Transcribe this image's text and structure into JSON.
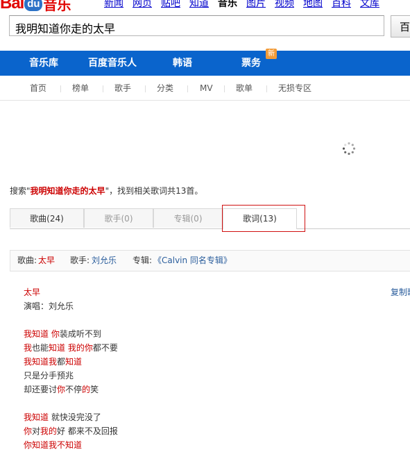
{
  "logo": {
    "bai": "Bai",
    "du": "du",
    "yinyue": "音乐"
  },
  "top_nav": [
    "新闻",
    "网页",
    "贴吧",
    "知道",
    "音乐",
    "图片",
    "视频",
    "地图",
    "百科",
    "文库"
  ],
  "top_nav_active": "音乐",
  "search": {
    "query": "我明知道你走的太早",
    "button": "百"
  },
  "main_nav": [
    "音乐库",
    "百度音乐人",
    "韩语",
    "票务"
  ],
  "new_badge": "新",
  "sub_nav": [
    "首页",
    "榜单",
    "歌手",
    "分类",
    "MV",
    "歌单",
    "无损专区"
  ],
  "summary": {
    "prefix": "搜索",
    "quote_open": "\"",
    "keyword": "我明知道你走的太早",
    "quote_close": "\"",
    "suffix": "，找到相关歌词共13首。"
  },
  "tabs": [
    {
      "label": "歌曲(24)",
      "state": "normal"
    },
    {
      "label": "歌手(0)",
      "state": "disabled"
    },
    {
      "label": "专辑(0)",
      "state": "disabled"
    },
    {
      "label": "歌词(13)",
      "state": "active"
    }
  ],
  "song_info": {
    "song_label": "歌曲:",
    "song": "太早",
    "singer_label": "歌手:",
    "singer": "刘允乐",
    "album_label": "专辑:",
    "album": "《Calvin 同名专辑》"
  },
  "lyrics": {
    "title": "太早",
    "performer_line": "演唱：刘允乐",
    "copy_label": "复制歌词",
    "stanza1": [
      [
        {
          "t": "我知道",
          "h": true
        },
        {
          "t": " ",
          "h": false
        },
        {
          "t": "你",
          "h": true
        },
        {
          "t": "装成听不到",
          "h": false
        }
      ],
      [
        {
          "t": "我",
          "h": true
        },
        {
          "t": "也能",
          "h": false
        },
        {
          "t": "知道",
          "h": true
        },
        {
          "t": " ",
          "h": false
        },
        {
          "t": "我的你",
          "h": true
        },
        {
          "t": "都不要",
          "h": false
        }
      ],
      [
        {
          "t": "我知道我",
          "h": true
        },
        {
          "t": "都",
          "h": false
        },
        {
          "t": "知道",
          "h": true
        }
      ],
      [
        {
          "t": "只是分手预兆",
          "h": false
        }
      ],
      [
        {
          "t": "却还要讨",
          "h": false
        },
        {
          "t": "你",
          "h": true
        },
        {
          "t": "不停",
          "h": false
        },
        {
          "t": "的",
          "h": true
        },
        {
          "t": "笑",
          "h": false
        }
      ]
    ],
    "stanza2": [
      [
        {
          "t": "我知道",
          "h": true
        },
        {
          "t": " 就快没完没了",
          "h": false
        }
      ],
      [
        {
          "t": "你",
          "h": true
        },
        {
          "t": "对",
          "h": false
        },
        {
          "t": "我的",
          "h": true
        },
        {
          "t": "好 都来不及回报",
          "h": false
        }
      ],
      [
        {
          "t": "你知道我不知道",
          "h": true
        }
      ]
    ]
  }
}
